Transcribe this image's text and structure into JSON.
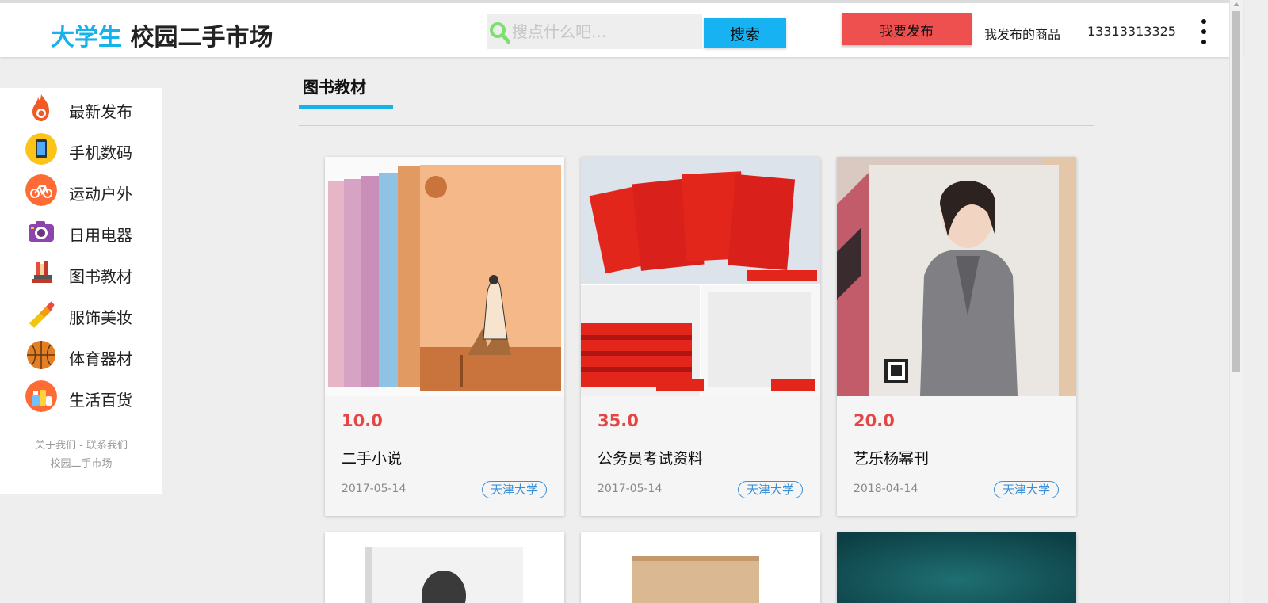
{
  "header": {
    "brand_accent": "大学生",
    "brand_main": "校园二手市场",
    "search_placeholder": "搜点什么吧...",
    "search_button": "搜索",
    "publish_button": "我要发布",
    "my_goods_link": "我发布的商品",
    "phone": "13313313325",
    "menu_icon": "more-vertical-icon"
  },
  "sidebar": {
    "items": [
      {
        "label": "最新发布",
        "icon": "fire-icon"
      },
      {
        "label": "手机数码",
        "icon": "phone-icon"
      },
      {
        "label": "运动户外",
        "icon": "bicycle-icon"
      },
      {
        "label": "日用电器",
        "icon": "camera-icon"
      },
      {
        "label": "图书教材",
        "icon": "books-icon"
      },
      {
        "label": "服饰美妆",
        "icon": "lipstick-icon"
      },
      {
        "label": "体育器材",
        "icon": "basketball-icon"
      },
      {
        "label": "生活百货",
        "icon": "groceries-icon"
      }
    ],
    "footer_links": "关于我们 - 联系我们",
    "footer_name": "校园二手市场"
  },
  "main": {
    "section_title": "图书教材",
    "products": [
      {
        "price": "10.0",
        "name": "二手小说",
        "date": "2017-05-14",
        "school": "天津大学"
      },
      {
        "price": "35.0",
        "name": "公务员考试资料",
        "date": "2017-05-14",
        "school": "天津大学"
      },
      {
        "price": "20.0",
        "name": "艺乐杨幂刊",
        "date": "2018-04-14",
        "school": "天津大学"
      }
    ]
  },
  "colors": {
    "accent": "#17b2ea",
    "publish": "#ee4f4f",
    "price": "#e64545",
    "tag": "#3a8fd8"
  }
}
